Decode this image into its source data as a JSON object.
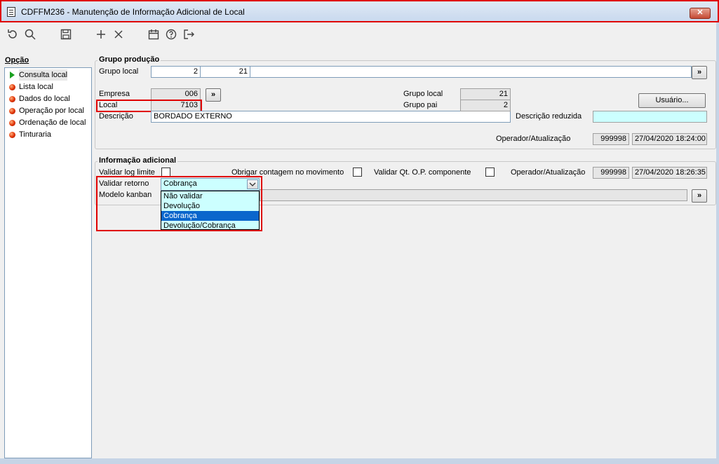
{
  "window": {
    "title": "CDFFM236 - Manutenção de Informação Adicional de Local",
    "close_label": "✕"
  },
  "toolbar": {
    "icons": [
      "refresh-icon",
      "search-icon",
      "save-icon",
      "add-icon",
      "delete-icon",
      "calendar-icon",
      "help-icon",
      "exit-icon"
    ]
  },
  "sidebar": {
    "title": "Opção",
    "items": [
      {
        "label": "Consulta local",
        "selected": true
      },
      {
        "label": "Lista local"
      },
      {
        "label": "Dados do local"
      },
      {
        "label": "Operação por local"
      },
      {
        "label": "Ordenação de local"
      },
      {
        "label": "Tinturaria"
      }
    ]
  },
  "grupo_producao": {
    "title": "Grupo produção",
    "grupo_local_label": "Grupo local",
    "grupo_local_value1": "2",
    "grupo_local_value2": "21",
    "nav_button": "»",
    "empresa_label": "Empresa",
    "empresa_value": "006",
    "empresa_button": "»",
    "local_label": "Local",
    "local_value": "7103",
    "descricao_label": "Descrição",
    "descricao_value": "BORDADO EXTERNO",
    "grupo_local_right_label": "Grupo local",
    "grupo_local_right_value": "21",
    "grupo_pai_label": "Grupo pai",
    "grupo_pai_value": "2",
    "usuario_button": "Usuário...",
    "descricao_reduzida_label": "Descrição reduzida",
    "descricao_reduzida_value": "",
    "operador_label": "Operador/Atualização",
    "operador_value": "999998",
    "atualizacao_value": "27/04/2020 18:24:00"
  },
  "info_adicional": {
    "title": "Informação adicional",
    "validar_log_label": "Validar log limite",
    "obrigar_contagem_label": "Obrigar contagem no movimento",
    "validar_qt_label": "Validar Qt. O.P. componente",
    "operador_label": "Operador/Atualização",
    "operador_value": "999998",
    "atualizacao_value": "27/04/2020 18:26:35",
    "validar_retorno_label": "Validar retorno",
    "validar_retorno_value": "Cobrança",
    "modelo_kanban_label": "Modelo kanban",
    "modelo_button": "»",
    "dropdown_options": [
      "Não validar",
      "Devolução",
      "Cobrança",
      "Devolução/Cobrança"
    ],
    "dropdown_selected": "Cobrança"
  }
}
